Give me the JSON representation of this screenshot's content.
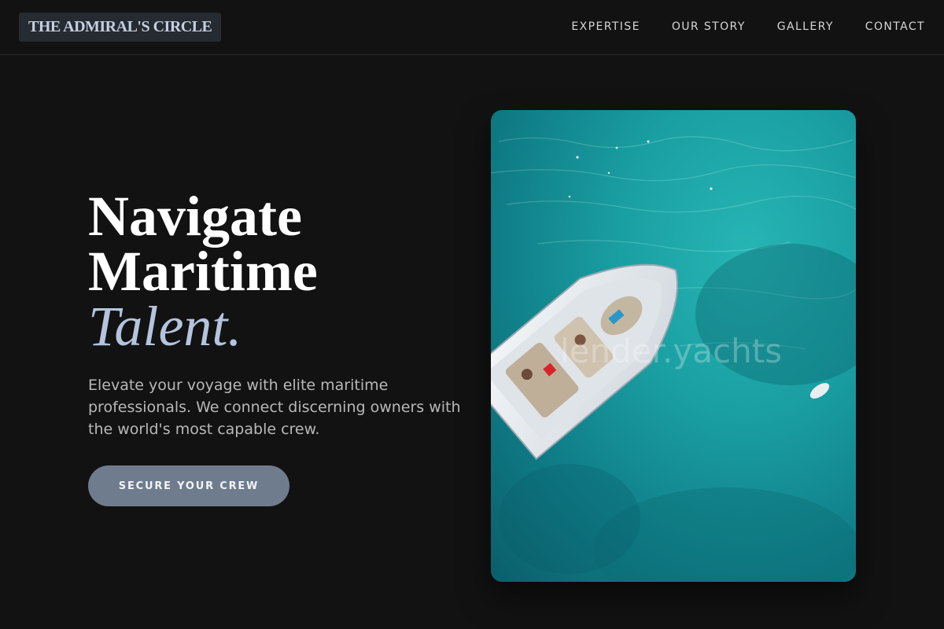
{
  "brand": {
    "logo_text": "THE ADMIRAL'S CIRCLE"
  },
  "nav": {
    "items": [
      "EXPERTISE",
      "OUR STORY",
      "GALLERY",
      "CONTACT"
    ]
  },
  "hero": {
    "headline_line1": "Navigate",
    "headline_line2": "Maritime",
    "headline_accent": "Talent.",
    "subtitle": "Elevate your voyage with elite maritime professionals. We connect discerning owners with the world's most capable crew.",
    "cta_label": "SECURE YOUR CREW",
    "image_watermark": "lender.yachts"
  },
  "colors": {
    "background": "#121212",
    "accent": "#b4c4de",
    "cta_background": "#6f7c8e",
    "water": "#1a9fa2"
  }
}
